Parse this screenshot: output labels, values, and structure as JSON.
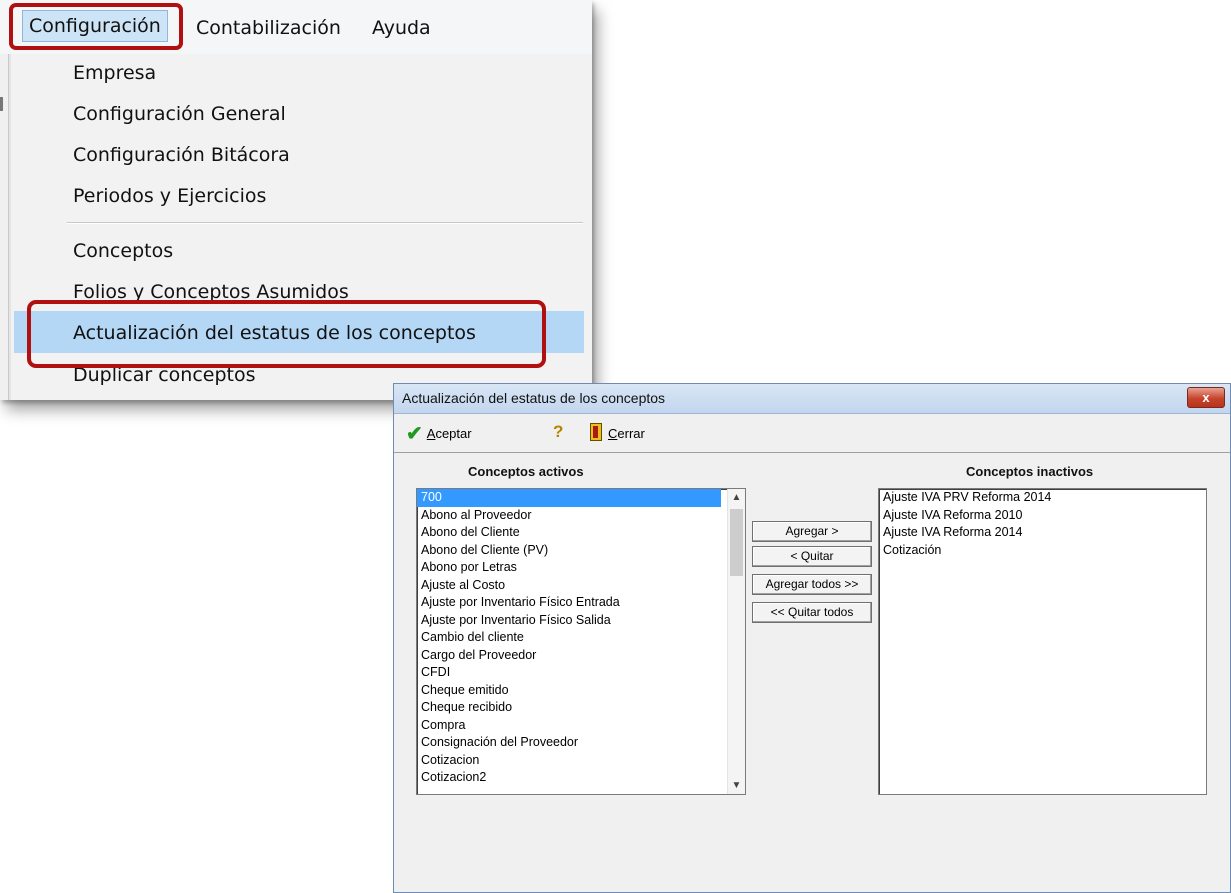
{
  "menubar": {
    "items": [
      "Configuración",
      "Contabilización",
      "Ayuda"
    ]
  },
  "dropdown": {
    "items": [
      "Empresa",
      "Configuración General",
      "Configuración Bitácora",
      "Periodos y Ejercicios",
      "Conceptos",
      "Folios y Conceptos Asumidos",
      "Actualización del estatus de los conceptos",
      "Duplicar conceptos"
    ],
    "highlighted_index": 6
  },
  "dialog": {
    "title": "Actualización del estatus de los conceptos",
    "close_label": "x",
    "toolbar": {
      "aceptar_accel": "A",
      "aceptar_rest": "ceptar",
      "cerrar_accel": "C",
      "cerrar_rest": "errar",
      "help_icon": "question-key-icon"
    },
    "activos_header": "Conceptos activos",
    "inactivos_header": "Conceptos inactivos",
    "activos": [
      "700",
      "Abono al Proveedor",
      "Abono del Cliente",
      "Abono del Cliente  (PV)",
      "Abono por Letras",
      "Ajuste al Costo",
      "Ajuste por Inventario Físico Entrada",
      "Ajuste por Inventario Físico Salida",
      "Cambio del cliente",
      "Cargo del Proveedor",
      "CFDI",
      "Cheque emitido",
      "Cheque recibido",
      "Compra",
      "Consignación del Proveedor",
      "Cotizacion",
      "Cotizacion2"
    ],
    "activos_selected": "700",
    "inactivos": [
      "Ajuste IVA PRV Reforma 2014",
      "Ajuste IVA Reforma 2010",
      "Ajuste IVA Reforma 2014",
      "Cotización"
    ],
    "buttons": {
      "agregar": "Agregar >",
      "quitar": "< Quitar",
      "agregar_todos": "Agregar todos >>",
      "quitar_todos": "<< Quitar todos"
    },
    "colors": {
      "selection": "#3399ff",
      "highlight_outline": "#b01010",
      "menu_hover": "#b3d7f5"
    }
  }
}
